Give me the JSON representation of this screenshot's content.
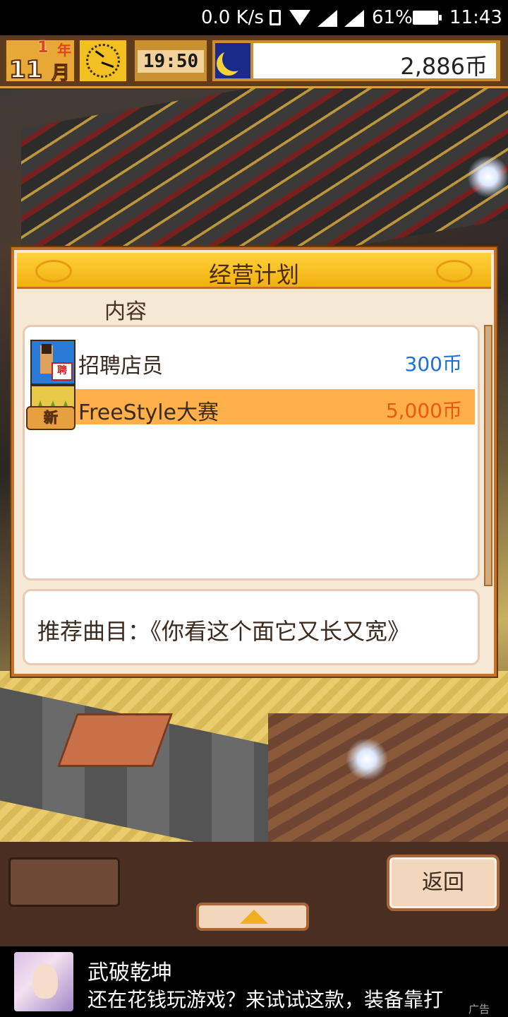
{
  "status_bar": {
    "network_speed": "0.0 K/s",
    "battery": "61%",
    "time": "11:43"
  },
  "hud": {
    "year_num": "1",
    "year_label": "年",
    "month_num": "11",
    "month_label": "月",
    "game_time": "19:50",
    "money": "2,886币"
  },
  "dialog": {
    "title": "经营计划",
    "column_header": "内容",
    "items": [
      {
        "label": "招聘店员",
        "price": "300币",
        "icon": "recruit-icon"
      },
      {
        "label": "FreeStyle大赛",
        "price": "5,000币",
        "icon": "event-icon",
        "badge": "新"
      }
    ],
    "recommendation": "推荐曲目：《你看这个面它又长又宽》"
  },
  "toolbar": {
    "back_label": "返回"
  },
  "ad": {
    "title": "武破乾坤",
    "subtitle": "还在花钱玩游戏？来试试这款，装备靠打",
    "tag": "广告"
  },
  "colors": {
    "price_blue": "#1e6fd6",
    "price_orange": "#e85a10",
    "highlight_row": "#ffb04a",
    "header_gold": "#ffd23a"
  }
}
